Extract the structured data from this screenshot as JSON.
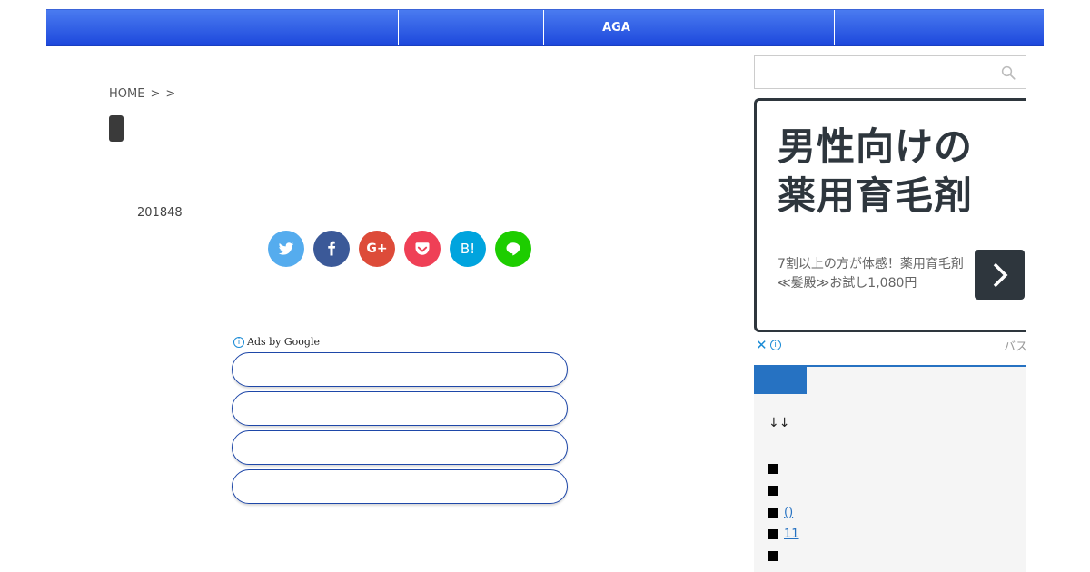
{
  "nav": {
    "items": [
      "",
      "",
      "",
      "AGA",
      "",
      ""
    ]
  },
  "breadcrumb": {
    "home": "HOME",
    "sep1": ">",
    "sep2": ">"
  },
  "post": {
    "date": "201848"
  },
  "share": {
    "buttons": [
      {
        "icon": "twitter-icon",
        "color": "#55acee"
      },
      {
        "icon": "facebook-icon",
        "color": "#3b5998"
      },
      {
        "icon": "google-plus-icon",
        "color": "#dd4b39",
        "label": "G+"
      },
      {
        "icon": "pocket-icon",
        "color": "#ef4056"
      },
      {
        "icon": "hatena-icon",
        "color": "#00a4de",
        "label": "B!"
      },
      {
        "icon": "line-icon",
        "color": "#1dcd00"
      }
    ]
  },
  "ads": {
    "label": "Ads by Google",
    "info_glyph": "i",
    "links": [
      "",
      "",
      "",
      ""
    ]
  },
  "search": {
    "placeholder": ""
  },
  "banner": {
    "headline_line1": "男性向けの",
    "headline_line2": "薬用育毛剤",
    "desc": "7割以上の方が体感！薬用育毛剤≪髪殿≫お試し1,080円",
    "close_glyph": "✕",
    "info_glyph": "i",
    "advertiser": "バスク"
  },
  "widget": {
    "arrows": "↓↓",
    "items": [
      "",
      "",
      "()",
      "11",
      ""
    ]
  },
  "colors": {
    "nav": "#1d48dc",
    "accent": "#2672c2",
    "banner_dark": "#2e363d"
  }
}
